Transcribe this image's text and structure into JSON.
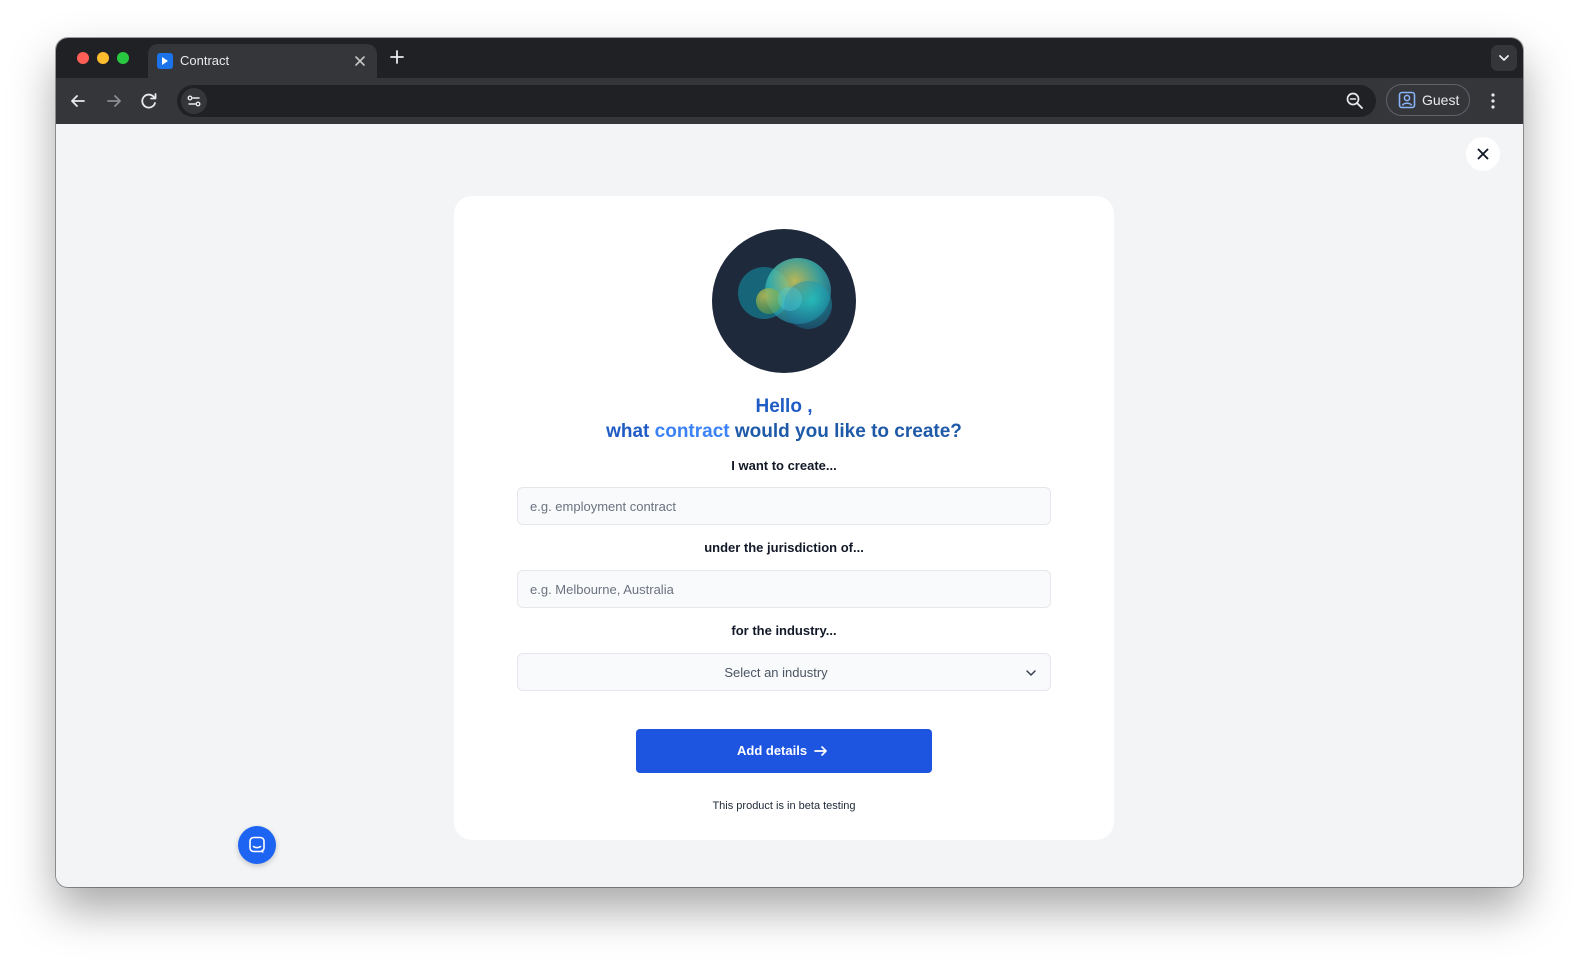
{
  "browser": {
    "tab_title": "Contract",
    "tab_favicon": "document-icon",
    "address": "",
    "profile_label": "Guest"
  },
  "colors": {
    "primary": "#1d55e0",
    "heading": "#1f5cc4",
    "heading_accent": "#3b82f6",
    "logo_bg": "#1e293b"
  },
  "greeting": {
    "line1": "Hello ,",
    "line2_before": "what ",
    "line2_accent": "contract",
    "line2_after": " would you like to create?"
  },
  "form": {
    "contract_label": "I want to create...",
    "contract_placeholder": "e.g. employment contract",
    "contract_value": "",
    "jurisdiction_label": "under the jurisdiction of...",
    "jurisdiction_placeholder": "e.g. Melbourne, Australia",
    "jurisdiction_value": "",
    "industry_label": "for the industry...",
    "industry_selected": "Select an industry",
    "submit_label": "Add details"
  },
  "footer_note": "This product is in beta testing"
}
